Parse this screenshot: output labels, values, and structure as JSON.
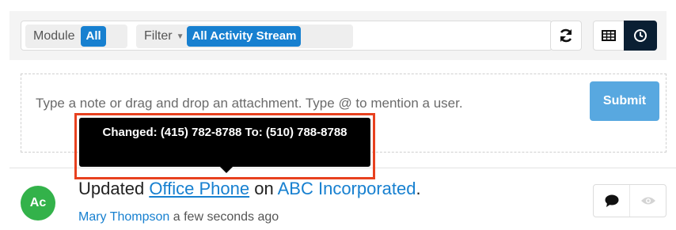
{
  "toolbar": {
    "module_label": "Module",
    "module_value": "All",
    "filter_label": "Filter",
    "filter_value": "All Activity Stream"
  },
  "compose": {
    "placeholder": "Type a note or drag and drop an attachment. Type @ to mention a user.",
    "submit_label": "Submit"
  },
  "tooltip": {
    "text": "Changed: (415) 782-8788 To: (510) 788-8788"
  },
  "activity": {
    "avatar_initials": "Ac",
    "action": "Updated",
    "field_link": "Office Phone",
    "preposition": "on",
    "record_link": "ABC Incorporated",
    "trailing": ".",
    "author": "Mary Thompson",
    "time": "a few seconds ago"
  },
  "icons": {
    "refresh": "refresh-icon",
    "table_view": "table-icon",
    "activity_view": "clock-icon",
    "comment": "comment-icon",
    "preview": "eye-icon"
  },
  "colors": {
    "accent": "#1780d0",
    "submit": "#58a8e0",
    "avatar": "#33b24a",
    "highlight": "#e8411f",
    "active_toggle": "#0a1f33"
  }
}
